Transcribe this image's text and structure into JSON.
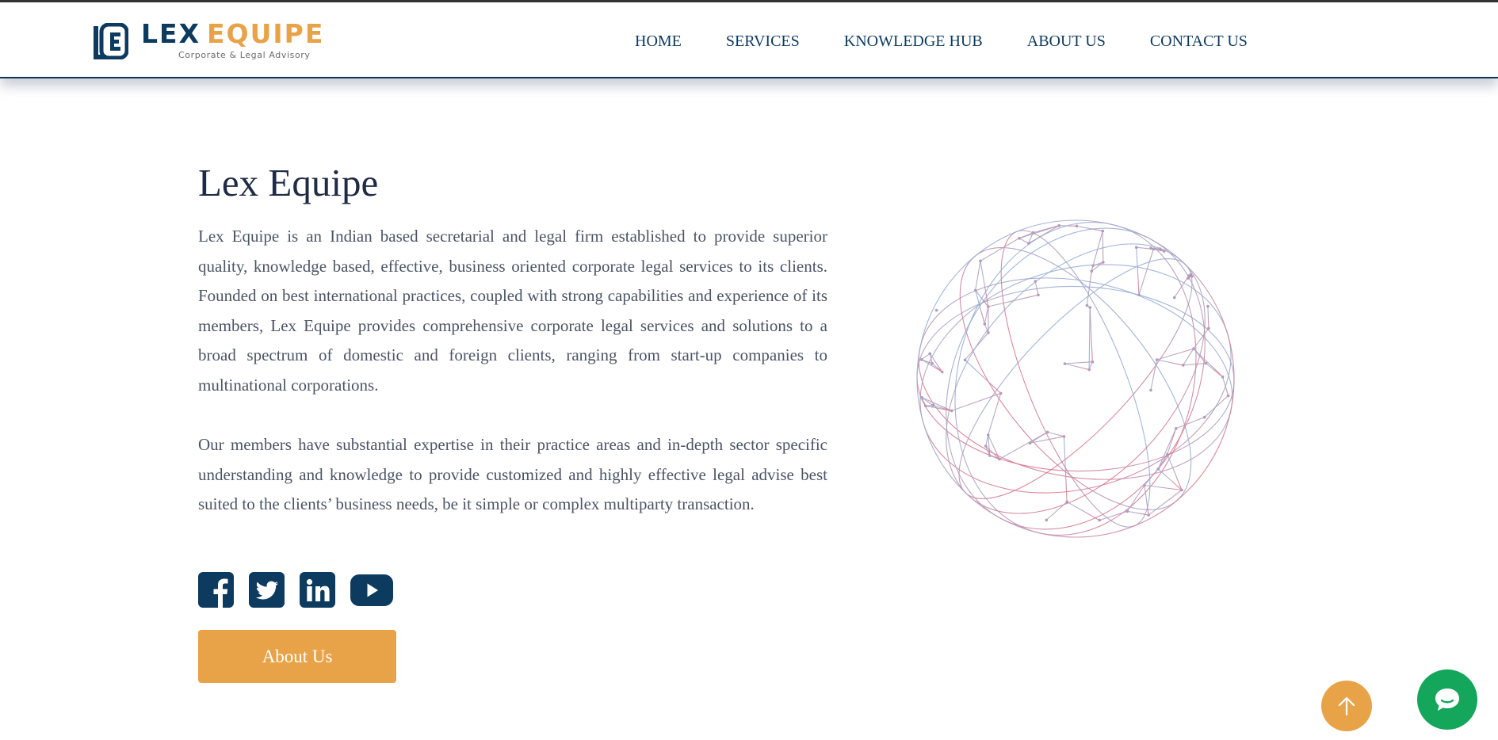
{
  "brand": {
    "name_part1": "LEX",
    "name_part2": "EQUIPE",
    "tagline": "Corporate & Legal Advisory",
    "colors": {
      "navy": "#0d3a5f",
      "gold": "#e8a349",
      "green": "#14a65a"
    }
  },
  "nav": {
    "items": [
      {
        "label": "HOME"
      },
      {
        "label": "SERVICES"
      },
      {
        "label": "KNOWLEDGE HUB"
      },
      {
        "label": "ABOUT US"
      },
      {
        "label": "CONTACT US"
      }
    ]
  },
  "hero": {
    "title": "Lex Equipe",
    "paragraph_1": "Lex Equipe is an Indian based secretarial and legal firm established to provide superior quality, knowledge based, effective, business oriented corporate legal services to its clients. Founded on best international practices, coupled with strong capabilities and experience of its members, Lex Equipe provides comprehensive corporate legal services and solutions to a broad spectrum of domestic and foreign clients, ranging from start-up companies to multinational corporations.",
    "paragraph_2": "Our members have substantial expertise in their practice areas and in-depth sector specific understanding and knowledge to provide customized and highly effective legal advise best suited to the clients’ business needs, be it simple or complex multiparty transaction.",
    "button_label": "About Us"
  },
  "social": {
    "icons": [
      "facebook-icon",
      "twitter-icon",
      "linkedin-icon",
      "youtube-icon"
    ]
  },
  "widgets": {
    "scroll_top_icon": "arrow-up-icon",
    "chat_icon": "chat-bubble-icon"
  }
}
